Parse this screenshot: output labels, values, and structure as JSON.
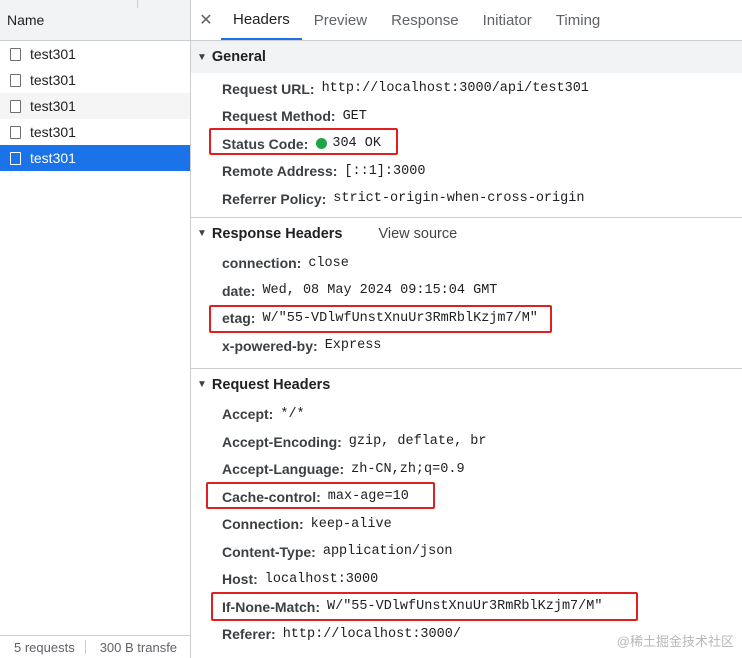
{
  "left_panel": {
    "header": "Name",
    "requests": [
      {
        "name": "test301",
        "selected": false
      },
      {
        "name": "test301",
        "selected": false
      },
      {
        "name": "test301",
        "selected": false
      },
      {
        "name": "test301",
        "selected": false
      },
      {
        "name": "test301",
        "selected": true
      }
    ],
    "footer": {
      "requests": "5 requests",
      "transferred": "300 B transfe"
    }
  },
  "tabs": [
    "Headers",
    "Preview",
    "Response",
    "Initiator",
    "Timing"
  ],
  "active_tab": "Headers",
  "general": {
    "title": "General",
    "request_url_label": "Request URL:",
    "request_url": "http://localhost:3000/api/test301",
    "request_method_label": "Request Method:",
    "request_method": "GET",
    "status_code_label": "Status Code:",
    "status_code": "304 OK",
    "remote_address_label": "Remote Address:",
    "remote_address": "[::1]:3000",
    "referrer_policy_label": "Referrer Policy:",
    "referrer_policy": "strict-origin-when-cross-origin"
  },
  "response_headers": {
    "title": "Response Headers",
    "view_source": "View source",
    "items": [
      {
        "key": "connection:",
        "value": "close"
      },
      {
        "key": "date:",
        "value": "Wed, 08 May 2024 09:15:04 GMT"
      },
      {
        "key": "etag:",
        "value": "W/\"55-VDlwfUnstXnuUr3RmRblKzjm7/M\""
      },
      {
        "key": "x-powered-by:",
        "value": "Express"
      }
    ]
  },
  "request_headers": {
    "title": "Request Headers",
    "items": [
      {
        "key": "Accept:",
        "value": "*/*"
      },
      {
        "key": "Accept-Encoding:",
        "value": "gzip, deflate, br"
      },
      {
        "key": "Accept-Language:",
        "value": "zh-CN,zh;q=0.9"
      },
      {
        "key": "Cache-control:",
        "value": "max-age=10"
      },
      {
        "key": "Connection:",
        "value": "keep-alive"
      },
      {
        "key": "Content-Type:",
        "value": "application/json"
      },
      {
        "key": "Host:",
        "value": "localhost:3000"
      },
      {
        "key": "If-None-Match:",
        "value": "W/\"55-VDlwfUnstXnuUr3RmRblKzjm7/M\""
      },
      {
        "key": "Referer:",
        "value": "http://localhost:3000/"
      }
    ]
  },
  "colors": {
    "status_ok": "#1ea446",
    "highlight": "#e02020",
    "selection": "#1a73e8"
  },
  "watermark": "@稀土掘金技术社区"
}
